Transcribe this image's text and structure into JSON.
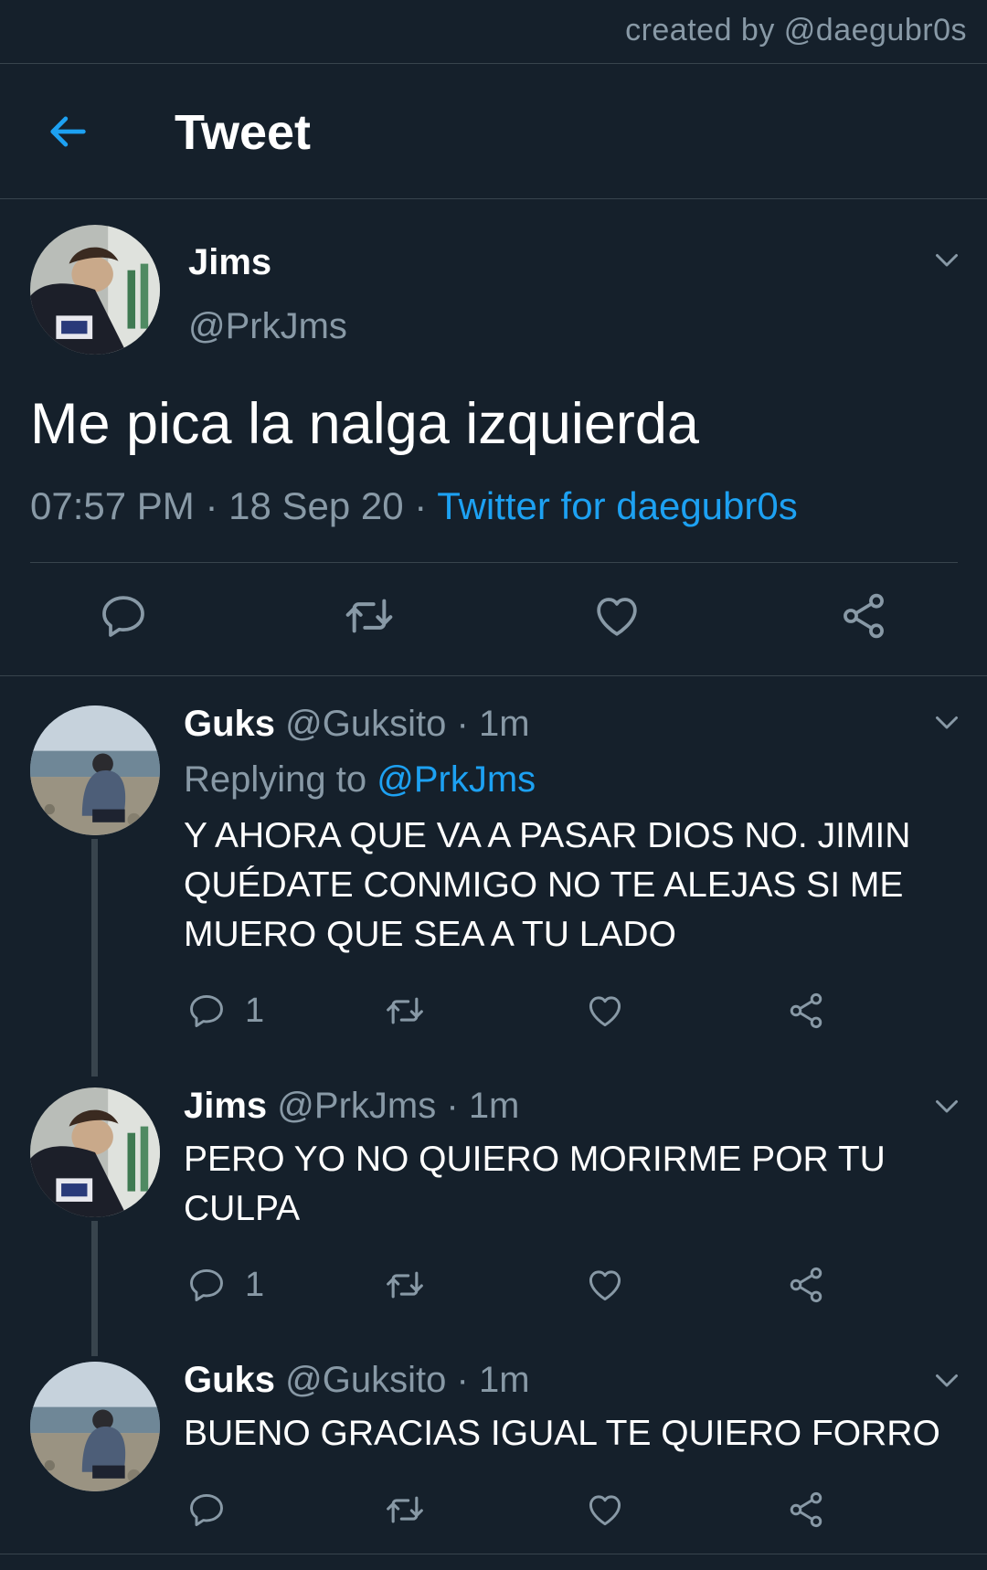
{
  "watermark": "created by @daegubr0s",
  "header": {
    "title": "Tweet"
  },
  "main_tweet": {
    "name": "Jims",
    "handle": "@PrkJms",
    "text": "Me pica la nalga izquierda",
    "time": "07:57 PM",
    "date": "18 Sep 20",
    "source": "Twitter for daegubr0s",
    "separator": " · "
  },
  "replies": [
    {
      "name": "Guks",
      "handle": "@Guksito",
      "age": "1m",
      "replying_label": "Replying to",
      "replying_handle": "@PrkJms",
      "text": "Y AHORA QUE VA A PASAR DIOS NO. JIMIN QUÉDATE CONMIGO NO TE ALEJAS SI ME MUERO QUE SEA A TU LADO",
      "reply_count": "1"
    },
    {
      "name": "Jims",
      "handle": "@PrkJms",
      "age": "1m",
      "text": "PERO YO NO QUIERO MORIRME POR TU CULPA",
      "reply_count": "1"
    },
    {
      "name": "Guks",
      "handle": "@Guksito",
      "age": "1m",
      "text": "BUENO GRACIAS IGUAL TE QUIERO FORRO",
      "reply_count": ""
    }
  ],
  "colors": {
    "background": "#15202b",
    "accent": "#1da1f2",
    "muted": "#8899a6",
    "divider": "#38444d"
  },
  "icons": [
    "back-arrow-icon",
    "chevron-down-icon",
    "reply-icon",
    "retweet-icon",
    "like-icon",
    "share-icon"
  ]
}
